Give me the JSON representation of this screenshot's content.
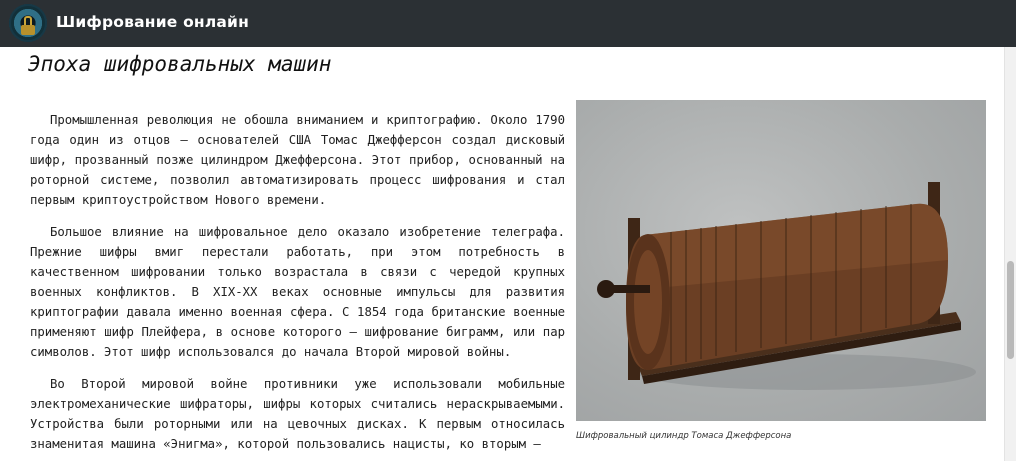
{
  "header": {
    "site_title": "Шифрование онлайн",
    "logo_icon": "lock-emblem-icon"
  },
  "article": {
    "heading": "Эпоха шифровальных машин",
    "paragraphs": [
      "Промышленная революция не обошла вниманием и криптографию. Около 1790 года один из отцов – основателей США Томас Джефферсон создал дисковый шифр, прозванный позже цилиндром Джефферсона. Этот прибор, основанный на роторной системе, позволил автоматизировать процесс шифрования и стал первым криптоустройством Нового времени.",
      "Большое влияние на шифровальное дело оказало изобретение телеграфа. Прежние шифры вмиг перестали работать, при этом потребность в качественном шифровании только возрастала в связи с чередой крупных военных конфликтов. В XIX-XX веках основные импульсы для развития криптографии давала именно военная сфера. С 1854 года британские военные применяют шифр Плейфера, в основе которого – шифрование биграмм, или пар символов. Этот шифр использовался до начала Второй мировой войны.",
      "Во Второй мировой войне противники уже использовали мобильные электромеханические шифраторы, шифры которых считались нераскрываемыми. Устройства были роторными или на цевочных дисках. К первым относилась знаменитая машина «Энигма», которой пользовались нацисты, ко вторым –"
    ]
  },
  "figure": {
    "caption": "Шифровальный цилиндр Томаса Джефферсона"
  },
  "colors": {
    "header_bg": "#2b3034",
    "header_text": "#ffffff",
    "body_text": "#222222"
  }
}
